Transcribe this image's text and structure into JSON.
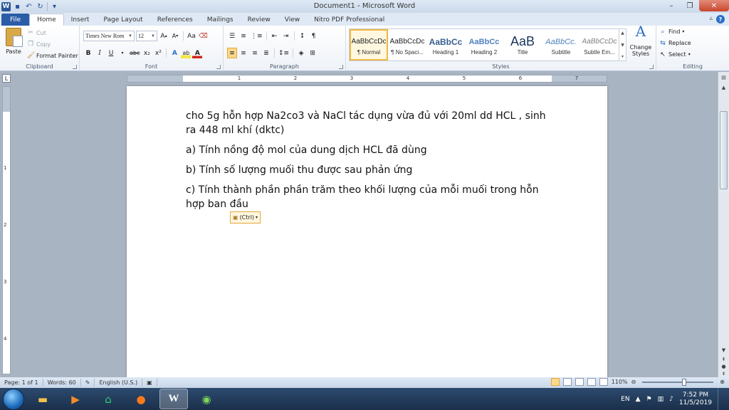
{
  "window": {
    "title": "Document1 - Microsoft Word",
    "controls": {
      "minimize": "–",
      "restore": "❐",
      "close": "✕"
    }
  },
  "qat": {
    "undo": "↶",
    "redo": "↻",
    "more": "▾"
  },
  "tabs": [
    "File",
    "Home",
    "Insert",
    "Page Layout",
    "References",
    "Mailings",
    "Review",
    "View",
    "Nitro PDF Professional"
  ],
  "ribbon": {
    "clipboard": {
      "label": "Clipboard",
      "paste": "Paste",
      "cut": "Cut",
      "copy": "Copy",
      "format_painter": "Format Painter"
    },
    "font": {
      "label": "Font",
      "font_name": "Times New Rom",
      "font_size": "12",
      "grow": "A",
      "shrink": "A",
      "change_case": "Aa",
      "bold": "B",
      "italic": "I",
      "underline": "U",
      "strike": "abc",
      "subscript": "x₂",
      "superscript": "x²",
      "text_effects": "A",
      "highlight": "ab",
      "font_color": "A"
    },
    "paragraph": {
      "label": "Paragraph",
      "show_marks": "¶"
    },
    "styles": {
      "label": "Styles",
      "items": [
        {
          "preview": "AaBbCcDc",
          "name": "¶ Normal"
        },
        {
          "preview": "AaBbCcDc",
          "name": "¶ No Spaci..."
        },
        {
          "preview": "AaBbCc",
          "name": "Heading 1"
        },
        {
          "preview": "AaBbCc",
          "name": "Heading 2"
        },
        {
          "preview": "AaB",
          "name": "Title"
        },
        {
          "preview": "AaBbCc.",
          "name": "Subtitle"
        },
        {
          "preview": "AaBbCcDc",
          "name": "Subtle Em..."
        }
      ],
      "change_styles_line1": "Change",
      "change_styles_line2": "Styles"
    },
    "editing": {
      "label": "Editing",
      "find": "Find",
      "replace": "Replace",
      "select": "Select"
    }
  },
  "ruler": {
    "numbers": [
      "1",
      "2",
      "3",
      "4",
      "5",
      "6",
      "7"
    ],
    "vnumbers": [
      "1",
      "2",
      "3",
      "4"
    ]
  },
  "document": {
    "paragraphs": [
      "cho 5g hỗn hợp Na2co3 và NaCl tác dụng vừa đủ với 20ml dd HCL , sinh ra 448 ml khí (dktc)",
      "a) Tính nồng độ mol của dung dịch HCL đã dùng",
      "b) Tính số lượng muối thu được sau phản ứng",
      "c) Tính thành phần phần trăm theo khối lượng của mỗi muối trong hỗn hợp ban đầu"
    ],
    "paste_options": "(Ctrl)"
  },
  "status": {
    "page": "Page: 1 of 1",
    "words": "Words: 60",
    "language": "English (U.S.)",
    "zoom": "110%"
  },
  "taskbar": {
    "language": "EN",
    "time": "7:52 PM",
    "date": "11/5/2019"
  }
}
